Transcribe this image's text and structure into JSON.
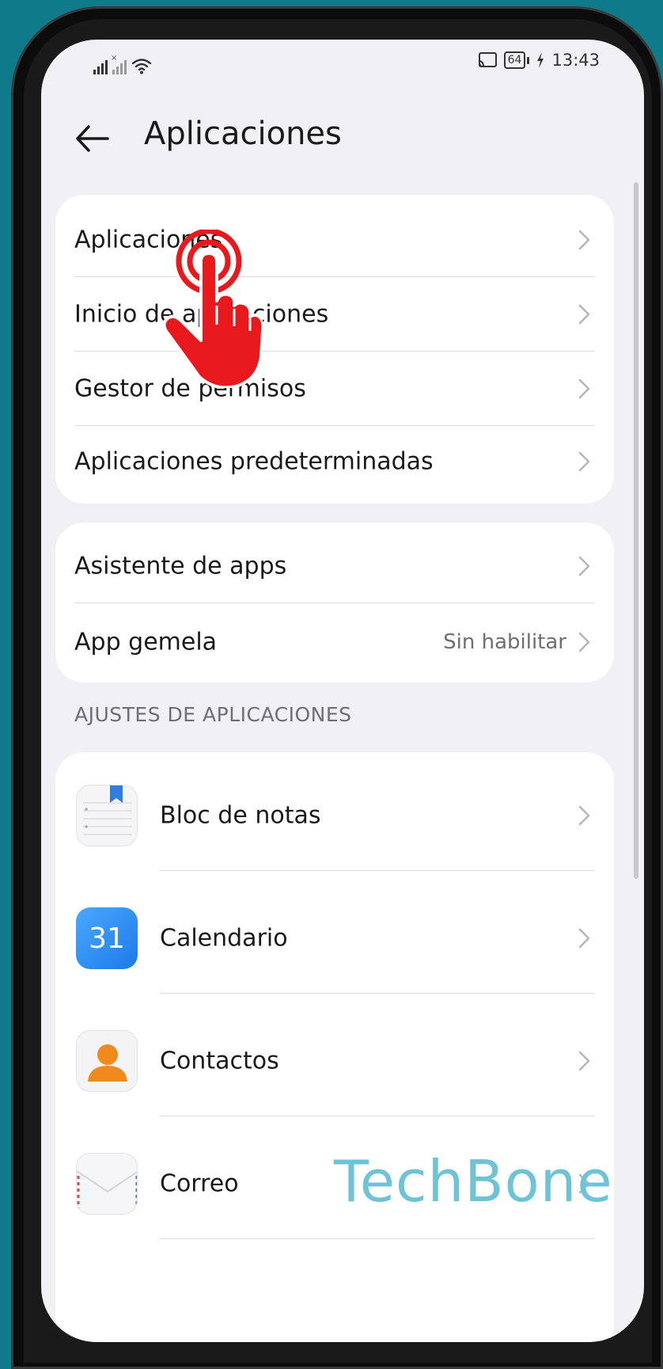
{
  "status_bar": {
    "time": "13:43",
    "battery": "64"
  },
  "header": {
    "title": "Aplicaciones"
  },
  "card1": [
    {
      "label": "Aplicaciones"
    },
    {
      "label": "Inicio de aplicaciones"
    },
    {
      "label": "Gestor de permisos"
    },
    {
      "label": "Aplicaciones predeterminadas"
    }
  ],
  "card2": [
    {
      "label": "Asistente de apps",
      "value": ""
    },
    {
      "label": "App gemela",
      "value": "Sin habilitar"
    }
  ],
  "section": {
    "title": "AJUSTES DE APLICACIONES"
  },
  "apps": [
    {
      "label": "Bloc de notas",
      "icon": "notepad-icon"
    },
    {
      "label": "Calendario",
      "icon": "calendar-icon",
      "icon_text": "31"
    },
    {
      "label": "Contactos",
      "icon": "contacts-icon"
    },
    {
      "label": "Correo",
      "icon": "mail-icon"
    }
  ],
  "watermark": "TechBone",
  "colors": {
    "background": "#0f7a89",
    "screen": "#f0f0f5",
    "card": "#ffffff",
    "tap_hand": "#e8191c",
    "calendar": "#2f8ff0",
    "contacts": "#f08a1c",
    "watermark": "#6ec3d6"
  }
}
